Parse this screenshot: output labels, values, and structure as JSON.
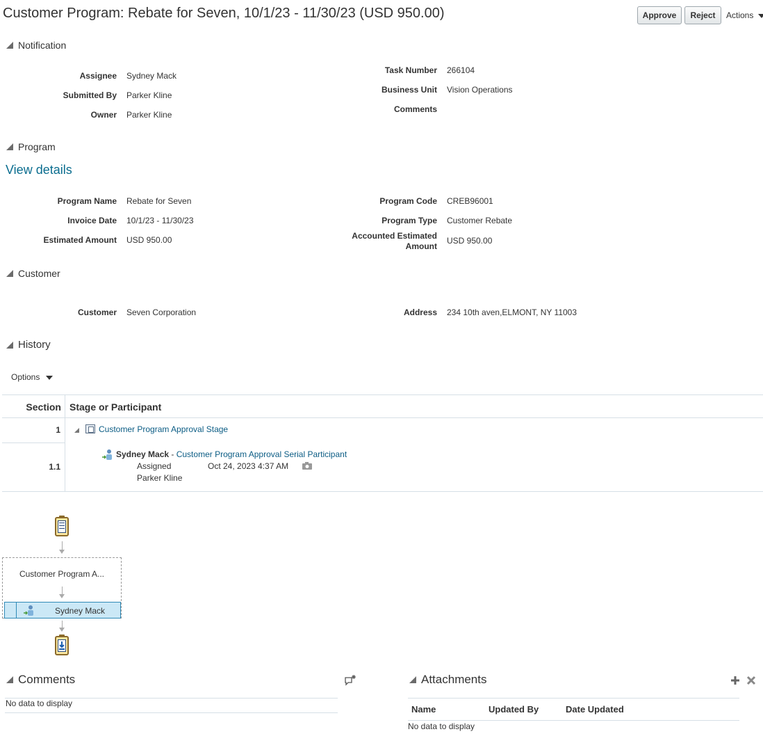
{
  "header": {
    "title": "Customer Program: Rebate for Seven, 10/1/23 - 11/30/23 (USD 950.00)",
    "approve_label": "Approve",
    "reject_label": "Reject",
    "actions_label": "Actions"
  },
  "notification": {
    "heading": "Notification",
    "assignee_label": "Assignee",
    "assignee": "Sydney Mack",
    "submitted_by_label": "Submitted By",
    "submitted_by": "Parker Kline",
    "owner_label": "Owner",
    "owner": "Parker Kline",
    "task_number_label": "Task Number",
    "task_number": "266104",
    "business_unit_label": "Business Unit",
    "business_unit": "Vision Operations",
    "comments_label": "Comments",
    "comments": ""
  },
  "program": {
    "heading": "Program",
    "view_details": "View details",
    "program_name_label": "Program Name",
    "program_name": "Rebate for Seven",
    "invoice_date_label": "Invoice Date",
    "invoice_date": "10/1/23 - 11/30/23",
    "estimated_amount_label": "Estimated Amount",
    "estimated_amount": "USD 950.00",
    "program_code_label": "Program Code",
    "program_code": "CREB96001",
    "program_type_label": "Program Type",
    "program_type": "Customer Rebate",
    "accounted_label_1": "Accounted Estimated",
    "accounted_label_2": "Amount",
    "accounted_amount": "USD 950.00"
  },
  "customer": {
    "heading": "Customer",
    "customer_label": "Customer",
    "customer": "Seven Corporation",
    "address_label": "Address",
    "address": "234 10th aven,ELMONT, NY 11003"
  },
  "history": {
    "heading": "History",
    "options_label": "Options",
    "col_section": "Section",
    "col_stage": "Stage or Participant",
    "rows": [
      {
        "section": "1",
        "stage": "Customer Program Approval Stage"
      },
      {
        "section": "1.1",
        "participant_name": "Sydney Mack",
        "separator": " - ",
        "participant_role": "Customer Program Approval Serial Participant",
        "status": "Assigned",
        "date": "Oct 24, 2023 4:37 AM",
        "by": "Parker Kline"
      }
    ],
    "diagram": {
      "stage_label": "Customer Program A...",
      "participant_label": "Sydney Mack"
    }
  },
  "comments": {
    "heading": "Comments",
    "empty_text": "No data to display"
  },
  "attachments": {
    "heading": "Attachments",
    "col_name": "Name",
    "col_updated_by": "Updated By",
    "col_date_updated": "Date Updated",
    "empty_text": "No data to display"
  },
  "colors": {
    "link": "#0b5c84",
    "view_details": "#0b6d8f",
    "selected_participant_bg": "#cbe8f6",
    "selected_participant_border": "#2f8ab7"
  }
}
